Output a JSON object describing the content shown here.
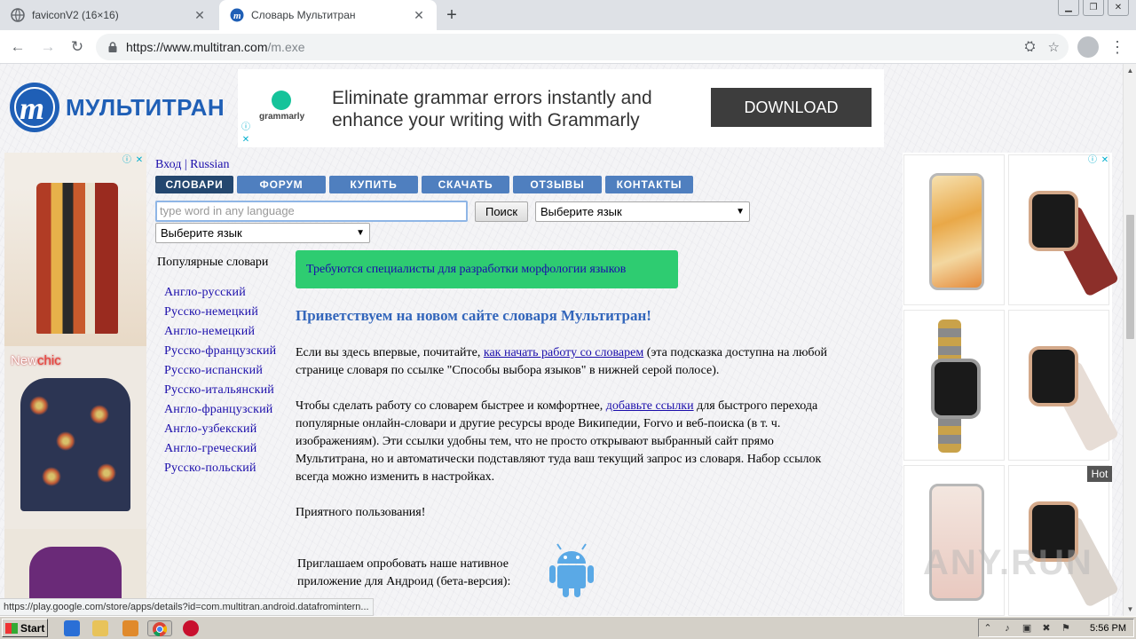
{
  "browser": {
    "tabs": [
      {
        "title": "faviconV2 (16×16)",
        "active": false
      },
      {
        "title": "Словарь Мультитран",
        "active": true
      }
    ],
    "url_host": "https://www.multitran.com",
    "url_path": "/m.exe"
  },
  "site": {
    "logo_text": "МУЛЬТИТРАН",
    "top_links": {
      "login": "Вход",
      "separator": "|",
      "language": "Russian"
    },
    "nav_tabs": [
      {
        "label": "СЛОВАРИ",
        "active": true
      },
      {
        "label": "ФОРУМ",
        "active": false
      },
      {
        "label": "КУПИТЬ",
        "active": false
      },
      {
        "label": "СКАЧАТЬ",
        "active": false
      },
      {
        "label": "ОТЗЫВЫ",
        "active": false
      },
      {
        "label": "КОНТАКТЫ",
        "active": false
      }
    ],
    "search": {
      "placeholder": "type word in any language",
      "button": "Поиск"
    },
    "select_lang_1": "Выберите язык",
    "select_lang_2": "Выберите язык",
    "popular_title": "Популярные словари",
    "popular_dicts": [
      "Англо-русский",
      "Русско-немецкий",
      "Англо-немецкий",
      "Русско-французский",
      "Русско-испанский",
      "Русско-итальянский",
      "Англо-французский",
      "Англо-узбекский",
      "Англо-греческий",
      "Русско-польский"
    ],
    "notice": "Требуются специалисты для разработки морфологии языков",
    "welcome": "Приветствуем на новом сайте словаря Мультитран!",
    "p1_a": "Если вы здесь впервые, почитайте, ",
    "p1_link": "как начать работу со словарем",
    "p1_b": " (эта подсказка доступна на любой",
    "p1_c": "странице словаря по ссылке \"Способы выбора языков\" в нижней серой полосе).",
    "p2_a": "Чтобы сделать работу со словарем быстрее и комфортнее, ",
    "p2_link": "добавьте ссылки",
    "p2_b": " для быстрого перехода",
    "p2_c": "популярные онлайн-словари и другие ресурсы вроде Википедии, Forvo и веб-поиска (в т. ч.",
    "p2_d": "изображениям). Эти ссылки удобны тем, что не просто открывают выбранный сайт прямо",
    "p2_e": "Мультитрана, но и автоматически подставляют туда ваш текущий запрос из словаря. Набор ссылок",
    "p2_f": "всегда можно изменить в настройках.",
    "p3": "Приятного пользования!",
    "android_1": "Приглашаем опробовать наше нативное",
    "android_2": "приложение для Андроид (бета-версия):"
  },
  "ads": {
    "top": {
      "brand": "grammarly",
      "headline": "Eliminate grammar errors instantly and enhance your writing with Grammarly",
      "cta": "DOWNLOAD"
    },
    "left_brand_a": "New",
    "left_brand_b": "chic",
    "right_hot": "Hot"
  },
  "status_url": "https://play.google.com/store/apps/details?id=com.multitran.android.datafromintern...",
  "taskbar": {
    "start": "Start",
    "clock": "5:56 PM"
  },
  "watermark": "ANY.RUN"
}
